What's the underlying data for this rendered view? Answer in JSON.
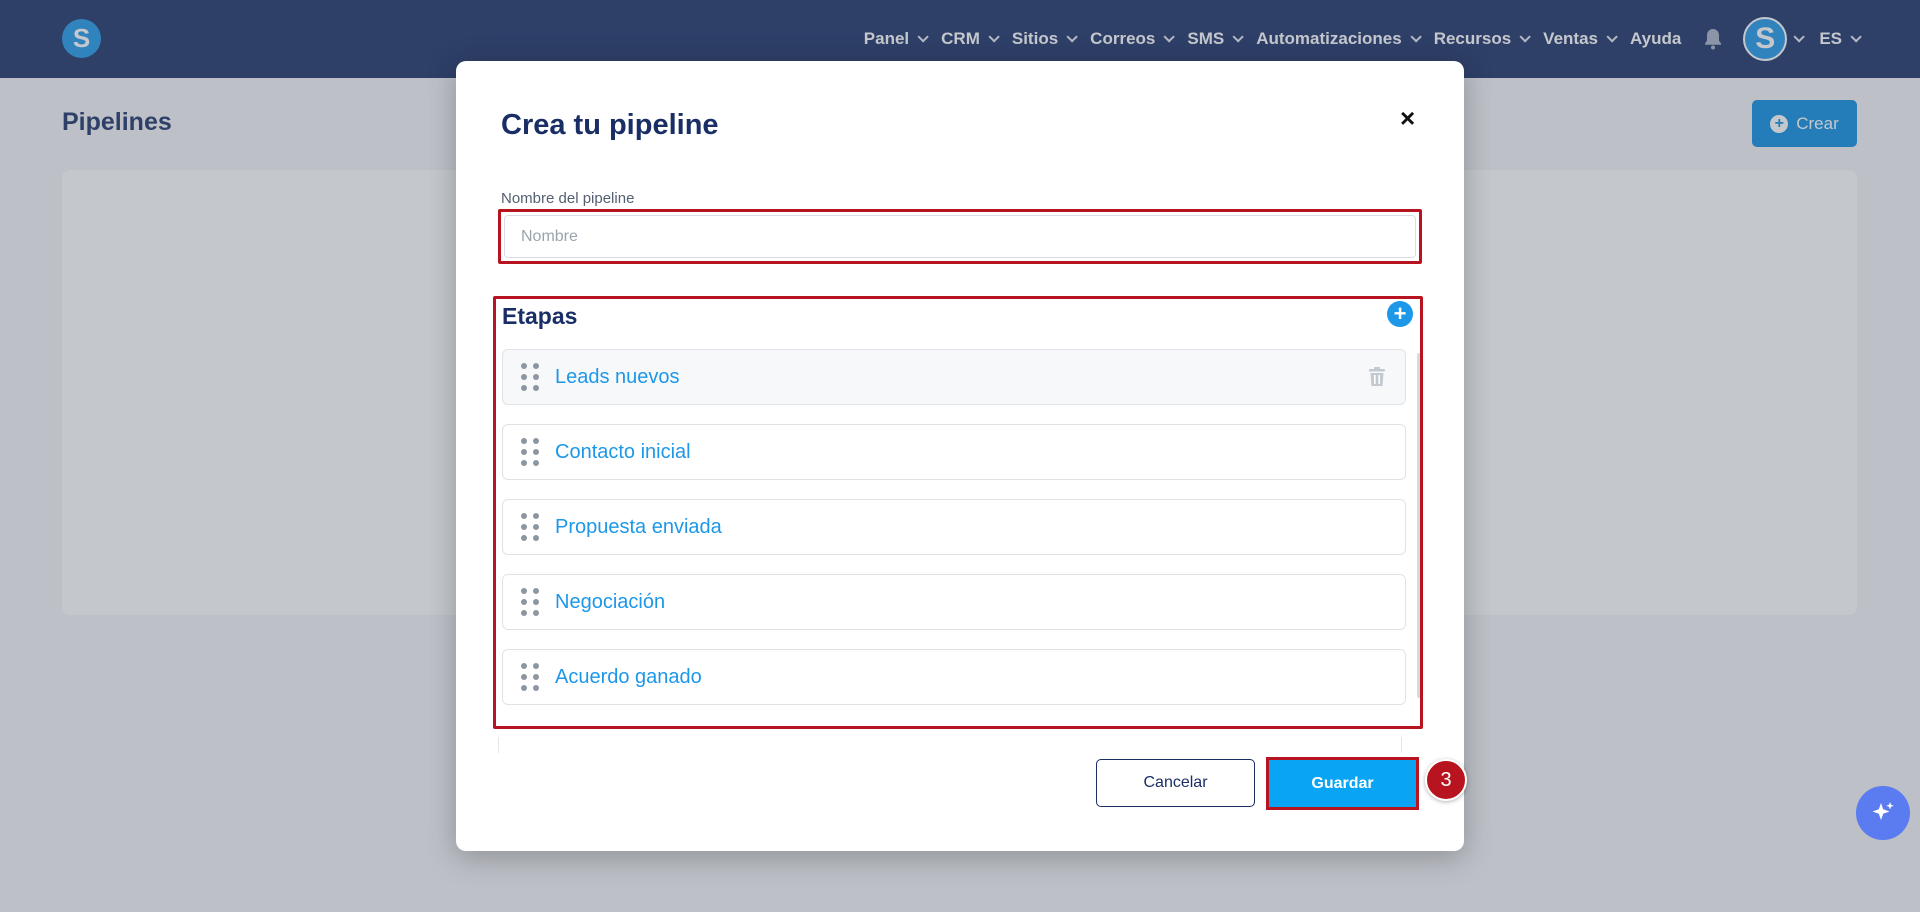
{
  "navbar": {
    "logo_letter": "S",
    "items": [
      {
        "label": "Panel",
        "has_menu": true
      },
      {
        "label": "CRM",
        "has_menu": true
      },
      {
        "label": "Sitios",
        "has_menu": true
      },
      {
        "label": "Correos",
        "has_menu": true
      },
      {
        "label": "SMS",
        "has_menu": true
      },
      {
        "label": "Automatizaciones",
        "has_menu": true
      },
      {
        "label": "Recursos",
        "has_menu": true
      },
      {
        "label": "Ventas",
        "has_menu": true
      },
      {
        "label": "Ayuda",
        "has_menu": false
      }
    ],
    "avatar_letter": "S",
    "language": "ES"
  },
  "page": {
    "title": "Pipelines",
    "create_label": "Crear"
  },
  "modal": {
    "title": "Crea tu pipeline",
    "close_icon": "×",
    "name_label": "Nombre del pipeline",
    "name_placeholder": "Nombre",
    "name_value": "",
    "stages_title": "Etapas",
    "stages": [
      {
        "name": "Leads nuevos"
      },
      {
        "name": "Contacto inicial"
      },
      {
        "name": "Propuesta enviada"
      },
      {
        "name": "Negociación"
      },
      {
        "name": "Acuerdo ganado"
      }
    ],
    "cancel_label": "Cancelar",
    "save_label": "Guardar"
  },
  "annotation": {
    "step_number": "3"
  },
  "colors": {
    "navbar_bg": "#1a2e66",
    "accent": "#1d97e8",
    "save_button": "#0aa4f4",
    "highlight_border": "#b8141f"
  }
}
